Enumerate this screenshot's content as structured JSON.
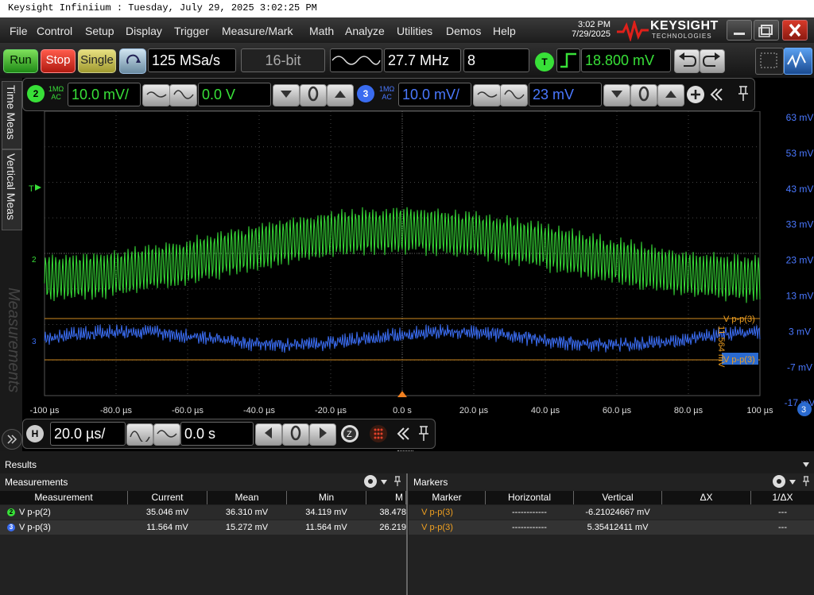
{
  "window_title": "Keysight Infiniium : Tuesday, July 29, 2025 3:02:25 PM",
  "menu": [
    "File",
    "Control",
    "Setup",
    "Display",
    "Trigger",
    "Measure/Mark",
    "Math",
    "Analyze",
    "Utilities",
    "Demos",
    "Help"
  ],
  "clock": {
    "time": "3:02 PM",
    "date": "7/29/2025"
  },
  "brand": {
    "name": "KEYSIGHT",
    "sub": "TECHNOLOGIES"
  },
  "toolbar": {
    "run": "Run",
    "stop": "Stop",
    "single": "Single",
    "sample_rate": "125 MSa/s",
    "bits": "16-bit",
    "frequency": "27.7 MHz",
    "count": "8",
    "trigger_badge": "T",
    "trigger_level": "18.800 mV"
  },
  "channel2": {
    "number": "2",
    "imp1": "1MΩ",
    "imp2": "AC",
    "scale": "10.0 mV/",
    "offset": "0.0 V",
    "color": "#38e038"
  },
  "channel3": {
    "number": "3",
    "imp1": "1MΩ",
    "imp2": "AC",
    "scale": "10.0 mV/",
    "offset": "23 mV",
    "color": "#3a6cf0"
  },
  "side_tabs": [
    "Time Meas",
    "Vertical Meas",
    "Measurements"
  ],
  "y_labels": [
    "63 mV",
    "53 mV",
    "43 mV",
    "33 mV",
    "23 mV",
    "13 mV",
    "3 mV",
    "-7 mV",
    "-17 mV"
  ],
  "x_labels": [
    "-100 µs",
    "-80.0 µs",
    "-60.0 µs",
    "-40.0 µs",
    "-20.0 µs",
    "0.0 s",
    "20.0 µs",
    "40.0 µs",
    "60.0 µs",
    "80.0 µs",
    "100 µs"
  ],
  "plot_labels": {
    "trigger_marker": "T",
    "ch2_marker": "2",
    "ch3_marker": "3",
    "y_axis_badge": "3",
    "cursor_label_top": "V p-p(3)",
    "cursor_label_bottom": "V p-p(3)",
    "cursor_value": "11.564 mV"
  },
  "horizontal": {
    "badge": "H",
    "scale": "20.0 µs/",
    "position": "0.0 s"
  },
  "results": {
    "title": "Results",
    "measurements_title": "Measurements",
    "markers_title": "Markers",
    "meas_columns": [
      "Measurement",
      "Current",
      "Mean",
      "Min",
      "M"
    ],
    "meas_rows": [
      {
        "badge": "2",
        "name": "V p-p(2)",
        "current": "35.046 mV",
        "mean": "36.310 mV",
        "min": "34.119 mV",
        "max": "38.478"
      },
      {
        "badge": "3",
        "name": "V p-p(3)",
        "current": "11.564 mV",
        "mean": "15.272 mV",
        "min": "11.564 mV",
        "max": "26.219"
      }
    ],
    "marker_columns": [
      "Marker",
      "Horizontal",
      "Vertical",
      "ΔX",
      "1/ΔX"
    ],
    "marker_rows": [
      {
        "marker": "V p-p(3)",
        "horizontal": "------------",
        "vertical": "-6.21024667 mV",
        "dx": "",
        "inv": "---"
      },
      {
        "marker": "V p-p(3)",
        "horizontal": "------------",
        "vertical": "5.35412411 mV",
        "dx": "",
        "inv": "---"
      }
    ]
  }
}
